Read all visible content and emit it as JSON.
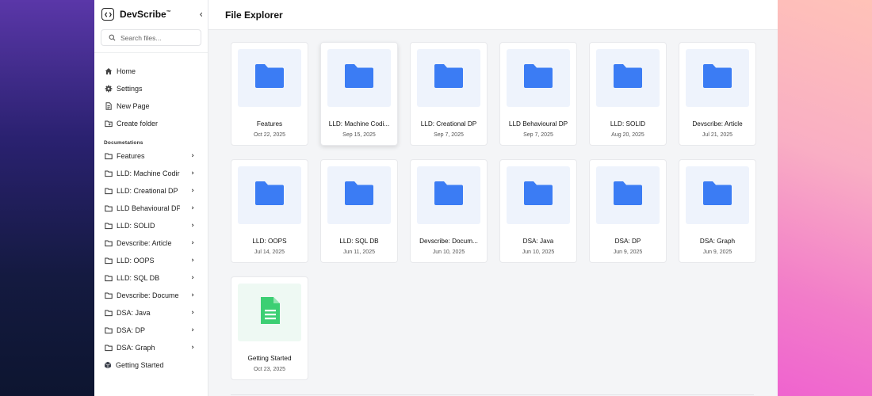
{
  "app": {
    "name": "DevScribe",
    "trademark": "™",
    "collapse_icon": "‹"
  },
  "search": {
    "placeholder": "Search files..."
  },
  "sidebar": {
    "main_items": [
      {
        "label": "Home",
        "icon": "home-icon"
      },
      {
        "label": "Settings",
        "icon": "gear-icon"
      },
      {
        "label": "New Page",
        "icon": "new-page-icon"
      },
      {
        "label": "Create folder",
        "icon": "create-folder-icon"
      }
    ],
    "section_label": "Documetations",
    "doc_items": [
      {
        "label": "Features"
      },
      {
        "label": "LLD: Machine Codir"
      },
      {
        "label": "LLD: Creational DP"
      },
      {
        "label": "LLD Behavioural DP"
      },
      {
        "label": "LLD: SOLID"
      },
      {
        "label": "Devscribe: Article"
      },
      {
        "label": "LLD: OOPS"
      },
      {
        "label": "LLD: SQL DB"
      },
      {
        "label": "Devscribe: Docume"
      },
      {
        "label": "DSA: Java"
      },
      {
        "label": "DSA: DP"
      },
      {
        "label": "DSA: Graph"
      }
    ],
    "getting_started": "Getting Started"
  },
  "header": {
    "title": "File Explorer"
  },
  "files": [
    {
      "title": "Features",
      "date": "Oct 22, 2025",
      "kind": "folder"
    },
    {
      "title": "LLD: Machine Codi...",
      "date": "Sep 15, 2025",
      "kind": "folder",
      "active": true
    },
    {
      "title": "LLD: Creational DP",
      "date": "Sep 7, 2025",
      "kind": "folder"
    },
    {
      "title": "LLD Behavioural DP",
      "date": "Sep 7, 2025",
      "kind": "folder"
    },
    {
      "title": "LLD: SOLID",
      "date": "Aug 20, 2025",
      "kind": "folder"
    },
    {
      "title": "Devscribe: Article",
      "date": "Jul 21, 2025",
      "kind": "folder"
    },
    {
      "title": "LLD: OOPS",
      "date": "Jul 14, 2025",
      "kind": "folder"
    },
    {
      "title": "LLD: SQL DB",
      "date": "Jun 11, 2025",
      "kind": "folder"
    },
    {
      "title": "Devscribe: Docum...",
      "date": "Jun 10, 2025",
      "kind": "folder"
    },
    {
      "title": "DSA: Java",
      "date": "Jun 10, 2025",
      "kind": "folder"
    },
    {
      "title": "DSA: DP",
      "date": "Jun 9, 2025",
      "kind": "folder"
    },
    {
      "title": "DSA: Graph",
      "date": "Jun 9, 2025",
      "kind": "folder"
    },
    {
      "title": "Getting Started",
      "date": "Oct 23, 2025",
      "kind": "document"
    }
  ],
  "colors": {
    "folder": "#3b7cf4",
    "document": "#3ccf73",
    "folder_bg": "#eef3fc",
    "document_bg": "#eef9f3"
  }
}
